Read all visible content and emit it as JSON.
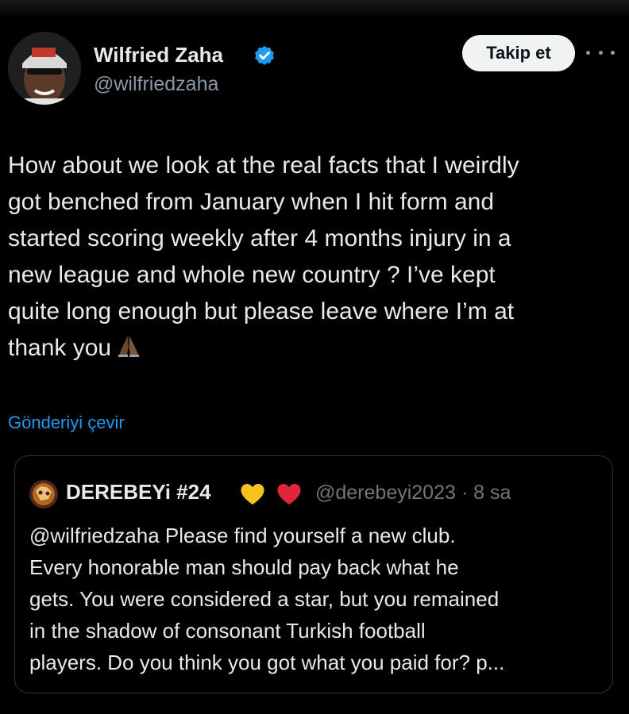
{
  "author": {
    "name": "Wilfried Zaha",
    "handle": "@wilfriedzaha",
    "verified": true
  },
  "actions": {
    "follow_label": "Takip et"
  },
  "tweet": {
    "lines": [
      "How about we look at the real facts that I weirdly",
      "got benched from January when I hit form and",
      "started scoring weekly after 4 months injury in a",
      "new league and whole new country ? I’ve kept",
      "quite long enough but please leave where I’m at",
      "thank you"
    ],
    "emoji": "folded-hands-icon",
    "translate_label": "Gönderiyi çevir"
  },
  "quote": {
    "name": "DEREBEYi #24",
    "name_emojis": [
      "yellow-heart-icon",
      "red-heart-icon"
    ],
    "handle_time": "@derebeyi2023 · 8 sa",
    "lines": [
      "@wilfriedzaha Please find yourself a new club.",
      "Every honorable man should pay back what he",
      "gets. You were considered a star, but you remained",
      "in the shadow of consonant Turkish football",
      "players. Do you think you got what you paid for? p..."
    ]
  },
  "colors": {
    "background": "#000000",
    "text": "#e7e9ea",
    "secondary": "#8b98a5",
    "link": "#1d9bf0",
    "verified": "#1d9bf0",
    "follow_bg": "#eff3f4",
    "border": "#2f3336"
  }
}
